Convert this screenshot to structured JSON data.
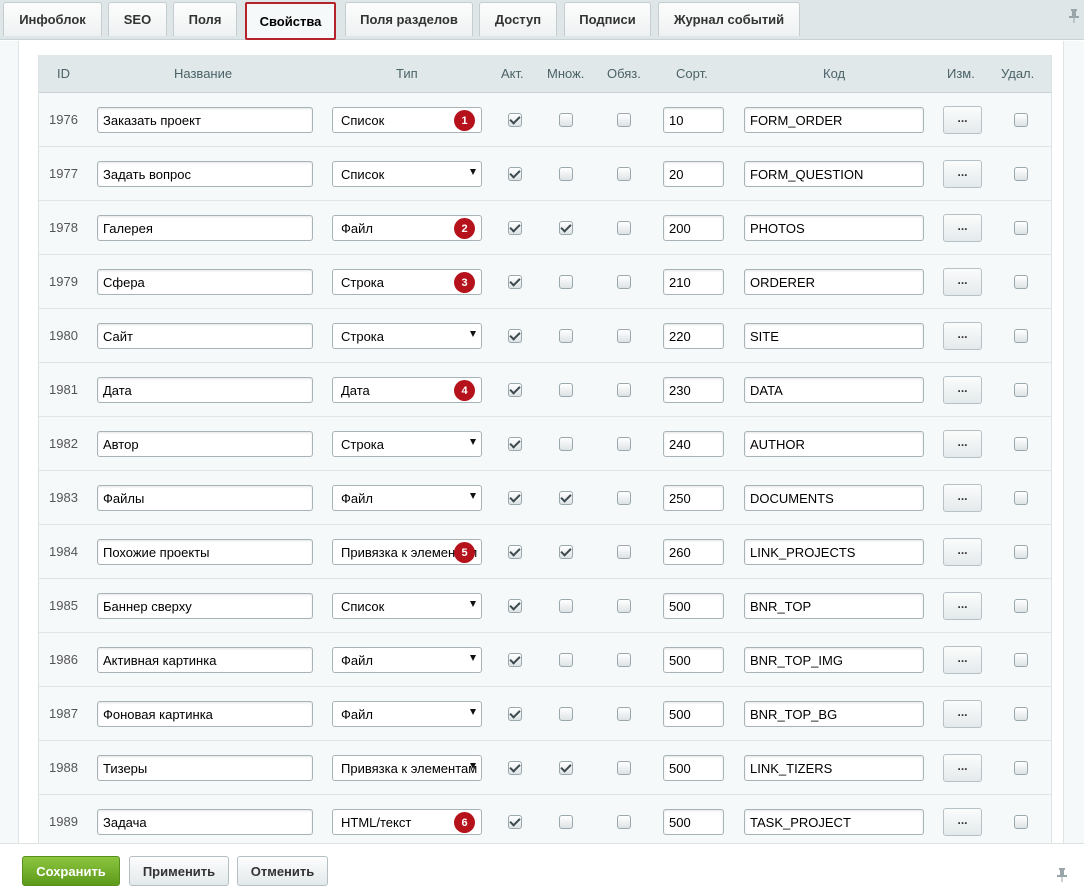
{
  "tabs": [
    "Инфоблок",
    "SEO",
    "Поля",
    "Свойства",
    "Поля разделов",
    "Доступ",
    "Подписи",
    "Журнал событий"
  ],
  "active_tab": "Свойства",
  "columns": {
    "id": "ID",
    "name": "Название",
    "type": "Тип",
    "active": "Акт.",
    "multiple": "Множ.",
    "required": "Обяз.",
    "sort": "Сорт.",
    "code": "Код",
    "edit": "Изм.",
    "delete": "Удал."
  },
  "edit_button_label": "...",
  "rows": [
    {
      "id": "1976",
      "name": "Заказать проект",
      "type": "Список",
      "badge": "1",
      "active": true,
      "multiple": false,
      "required": false,
      "sort": "10",
      "code": "FORM_ORDER",
      "delete": false
    },
    {
      "id": "1977",
      "name": "Задать вопрос",
      "type": "Список",
      "badge": "",
      "active": true,
      "multiple": false,
      "required": false,
      "sort": "20",
      "code": "FORM_QUESTION",
      "delete": false
    },
    {
      "id": "1978",
      "name": "Галерея",
      "type": "Файл",
      "badge": "2",
      "active": true,
      "multiple": true,
      "required": false,
      "sort": "200",
      "code": "PHOTOS",
      "delete": false
    },
    {
      "id": "1979",
      "name": "Сфера",
      "type": "Строка",
      "badge": "3",
      "active": true,
      "multiple": false,
      "required": false,
      "sort": "210",
      "code": "ORDERER",
      "delete": false
    },
    {
      "id": "1980",
      "name": "Сайт",
      "type": "Строка",
      "badge": "",
      "active": true,
      "multiple": false,
      "required": false,
      "sort": "220",
      "code": "SITE",
      "delete": false
    },
    {
      "id": "1981",
      "name": "Дата",
      "type": "Дата",
      "badge": "4",
      "active": true,
      "multiple": false,
      "required": false,
      "sort": "230",
      "code": "DATA",
      "delete": false
    },
    {
      "id": "1982",
      "name": "Автор",
      "type": "Строка",
      "badge": "",
      "active": true,
      "multiple": false,
      "required": false,
      "sort": "240",
      "code": "AUTHOR",
      "delete": false
    },
    {
      "id": "1983",
      "name": "Файлы",
      "type": "Файл",
      "badge": "",
      "active": true,
      "multiple": true,
      "required": false,
      "sort": "250",
      "code": "DOCUMENTS",
      "delete": false
    },
    {
      "id": "1984",
      "name": "Похожие проекты",
      "type": "Привязка к элементам",
      "badge": "5",
      "active": true,
      "multiple": true,
      "required": false,
      "sort": "260",
      "code": "LINK_PROJECTS",
      "delete": false
    },
    {
      "id": "1985",
      "name": "Баннер сверху",
      "type": "Список",
      "badge": "",
      "active": true,
      "multiple": false,
      "required": false,
      "sort": "500",
      "code": "BNR_TOP",
      "delete": false
    },
    {
      "id": "1986",
      "name": "Активная картинка",
      "type": "Файл",
      "badge": "",
      "active": true,
      "multiple": false,
      "required": false,
      "sort": "500",
      "code": "BNR_TOP_IMG",
      "delete": false
    },
    {
      "id": "1987",
      "name": "Фоновая картинка",
      "type": "Файл",
      "badge": "",
      "active": true,
      "multiple": false,
      "required": false,
      "sort": "500",
      "code": "BNR_TOP_BG",
      "delete": false
    },
    {
      "id": "1988",
      "name": "Тизеры",
      "type": "Привязка к элементам",
      "badge": "",
      "active": true,
      "multiple": true,
      "required": false,
      "sort": "500",
      "code": "LINK_TIZERS",
      "delete": false
    },
    {
      "id": "1989",
      "name": "Задача",
      "type": "HTML/текст",
      "badge": "6",
      "active": true,
      "multiple": false,
      "required": false,
      "sort": "500",
      "code": "TASK_PROJECT",
      "delete": false
    }
  ],
  "footer": {
    "save": "Сохранить",
    "apply": "Применить",
    "cancel": "Отменить"
  },
  "colors": {
    "accent_red": "#b5121b",
    "save_green": "#6fae2b"
  }
}
